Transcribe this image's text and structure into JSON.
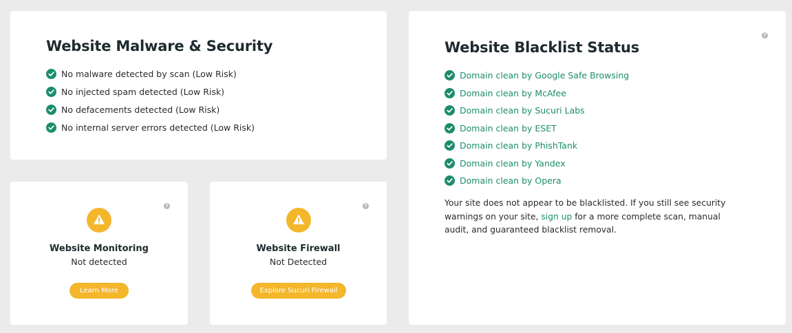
{
  "malware": {
    "title": "Website Malware & Security",
    "items": [
      "No malware detected by scan (Low Risk)",
      "No injected spam detected (Low Risk)",
      "No defacements detected (Low Risk)",
      "No internal server errors detected (Low Risk)"
    ]
  },
  "monitoring": {
    "title": "Website Monitoring",
    "status": "Not detected",
    "button": "Learn More",
    "help": "?"
  },
  "firewall": {
    "title": "Website Firewall",
    "status": "Not Detected",
    "button": "Explore Sucuri Firewall",
    "help": "?"
  },
  "blacklist": {
    "title": "Website Blacklist Status",
    "help": "?",
    "items": [
      "Domain clean by Google Safe Browsing",
      "Domain clean by McAfee",
      "Domain clean by Sucuri Labs",
      "Domain clean by ESET",
      "Domain clean by PhishTank",
      "Domain clean by Yandex",
      "Domain clean by Opera"
    ],
    "note_before": "Your site does not appear to be blacklisted. If you still see security warnings on your site, ",
    "note_link": "sign up",
    "note_after": " for a more complete scan, manual audit, and guaranteed blacklist removal."
  },
  "icons": {
    "check": "check-circle-icon",
    "warning": "warning-icon",
    "help": "question-icon"
  },
  "colors": {
    "green": "#1b8d6c",
    "warning": "#f4b62b",
    "background": "#ebebeb"
  }
}
